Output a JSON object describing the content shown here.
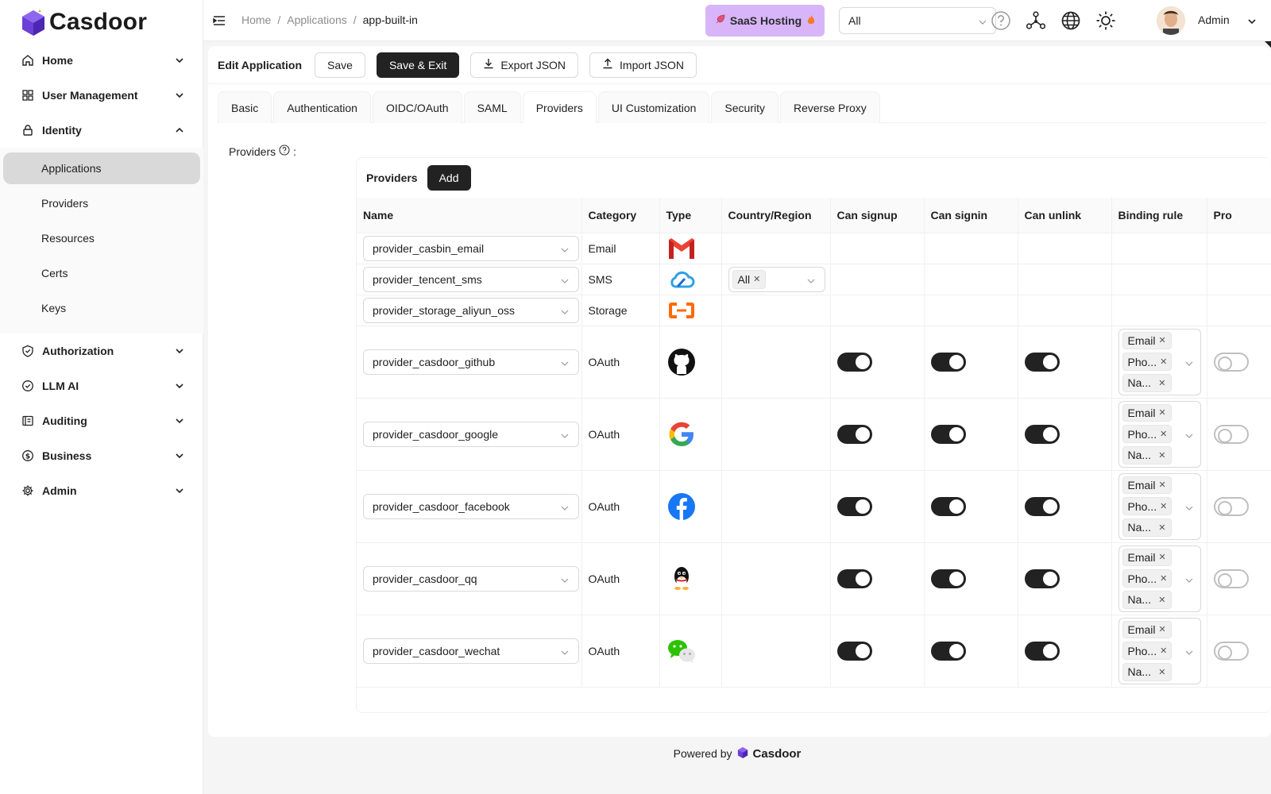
{
  "logo": {
    "text": "Casdoor",
    "icon": "casdoor-cube-icon"
  },
  "sidebar": {
    "items": [
      {
        "label": "Home",
        "icon": "home-icon"
      },
      {
        "label": "User Management",
        "icon": "grid-icon"
      },
      {
        "label": "Identity",
        "icon": "lock-icon",
        "expanded": true
      },
      {
        "label": "Authorization",
        "icon": "shield-check-icon"
      },
      {
        "label": "LLM AI",
        "icon": "check-circle-icon"
      },
      {
        "label": "Auditing",
        "icon": "audit-icon"
      },
      {
        "label": "Business",
        "icon": "dollar-icon"
      },
      {
        "label": "Admin",
        "icon": "gear-icon"
      }
    ],
    "identity_sub": [
      "Applications",
      "Providers",
      "Resources",
      "Certs",
      "Keys"
    ],
    "active_sub": "Applications"
  },
  "header": {
    "breadcrumb": [
      "Home",
      "Applications",
      "app-built-in"
    ],
    "separator": "/",
    "saas_label": "SaaS Hosting",
    "org_select": "All",
    "user_name": "Admin"
  },
  "toolbar": {
    "title": "Edit Application",
    "save": "Save",
    "save_exit": "Save & Exit",
    "export": "Export JSON",
    "import": "Import JSON"
  },
  "tabs": [
    "Basic",
    "Authentication",
    "OIDC/OAuth",
    "SAML",
    "Providers",
    "UI Customization",
    "Security",
    "Reverse Proxy"
  ],
  "active_tab": "Providers",
  "providers_field_label": "Providers",
  "providers_field_colon": ":",
  "providers_table": {
    "title": "Providers",
    "add_label": "Add",
    "columns": [
      "Name",
      "Category",
      "Type",
      "Country/Region",
      "Can signup",
      "Can signin",
      "Can unlink",
      "Binding rule",
      "Pro"
    ],
    "region_tag": "All",
    "binding_tags": [
      "Email",
      "Pho...",
      "Na..."
    ],
    "rows": [
      {
        "name": "provider_casbin_email",
        "category": "Email",
        "type_icon": "gmail-icon"
      },
      {
        "name": "provider_tencent_sms",
        "category": "SMS",
        "type_icon": "tencent-cloud-icon"
      },
      {
        "name": "provider_storage_aliyun_oss",
        "category": "Storage",
        "type_icon": "aliyun-icon"
      },
      {
        "name": "provider_casdoor_github",
        "category": "OAuth",
        "type_icon": "github-icon"
      },
      {
        "name": "provider_casdoor_google",
        "category": "OAuth",
        "type_icon": "google-icon"
      },
      {
        "name": "provider_casdoor_facebook",
        "category": "OAuth",
        "type_icon": "facebook-icon"
      },
      {
        "name": "provider_casdoor_qq",
        "category": "OAuth",
        "type_icon": "qq-icon"
      },
      {
        "name": "provider_casdoor_wechat",
        "category": "OAuth",
        "type_icon": "wechat-icon"
      }
    ]
  },
  "footer": {
    "prefix": "Powered by",
    "brand": "Casdoor"
  },
  "colors": {
    "accent": "#222222",
    "saas_bg": "#d7b5f8",
    "active_menu": "#d9d9d9"
  }
}
